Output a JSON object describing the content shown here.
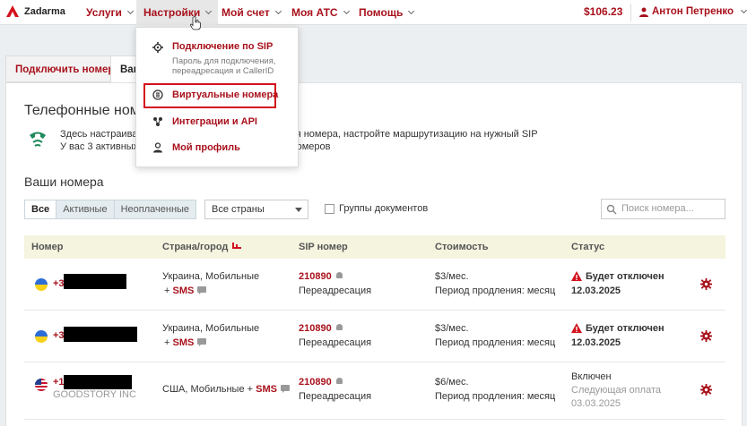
{
  "nav": {
    "logo": "Zadarma",
    "items": [
      "Услуги",
      "Настройки",
      "Мой счет",
      "Моя АТС",
      "Помощь"
    ],
    "balance": "$106.23",
    "user": "Антон Петренко"
  },
  "dropdown": {
    "items": [
      {
        "label": "Подключение по SIP",
        "sub1": "Пароль для подключения,",
        "sub2": "переадресация и CallerID"
      },
      {
        "label": "Виртуальные номера"
      },
      {
        "label": "Интеграции и API"
      },
      {
        "label": "Мой профиль"
      }
    ]
  },
  "tabs": {
    "connect": "Подключить номер",
    "yours": "Ваши номера"
  },
  "page": {
    "title": "Телефонные номе",
    "info_line1": "Здесь настраиван",
    "info_line1b": "имя номера, настройте маршрутизацию на нужный SIP",
    "info_line2": "У вас 3 активных",
    "info_line2b": "х номеров"
  },
  "numbers": {
    "title": "Ваши номера",
    "filters": [
      "Все",
      "Активные",
      "Неоплаченные"
    ],
    "country_select": "Все страны",
    "group_docs": "Группы документов",
    "search_placeholder": "Поиск номера..."
  },
  "table": {
    "headers": [
      "Номер",
      "Страна/город",
      "SIP номер",
      "Стоимость",
      "Статус"
    ],
    "rows": [
      {
        "flag": "ua",
        "number_prefix": "+3",
        "country": "Украина, Мобильные",
        "sms_plus": "+",
        "sms": "SMS",
        "sip": "210890",
        "sip_sub": "Переадресация",
        "price": "$3/мес.",
        "renewal": "Период продления: месяц",
        "status": "Будет отключен",
        "status_date": "12.03.2025"
      },
      {
        "flag": "ua",
        "number_prefix": "+3",
        "country": "Украина, Мобильные",
        "sms_plus": "+",
        "sms": "SMS",
        "sip": "210890",
        "sip_sub": "Переадресация",
        "price": "$3/мес.",
        "renewal": "Период продления: месяц",
        "status": "Будет отключен",
        "status_date": "12.03.2025"
      },
      {
        "flag": "us",
        "number_prefix": "+1",
        "number_sub": "GOODSTORY INC",
        "country": "США, Мобильные +",
        "sms": "SMS",
        "sip": "210890",
        "sip_sub": "Переадресация",
        "price": "$6/мес.",
        "renewal": "Период продления: месяц",
        "status": "Включен",
        "status_sub": "Следующая оплата",
        "status_date": "03.03.2025"
      }
    ]
  },
  "colors": {
    "brand": "#a8111c",
    "highlight": "#d3111c",
    "header_bg": "#f4f4df"
  }
}
